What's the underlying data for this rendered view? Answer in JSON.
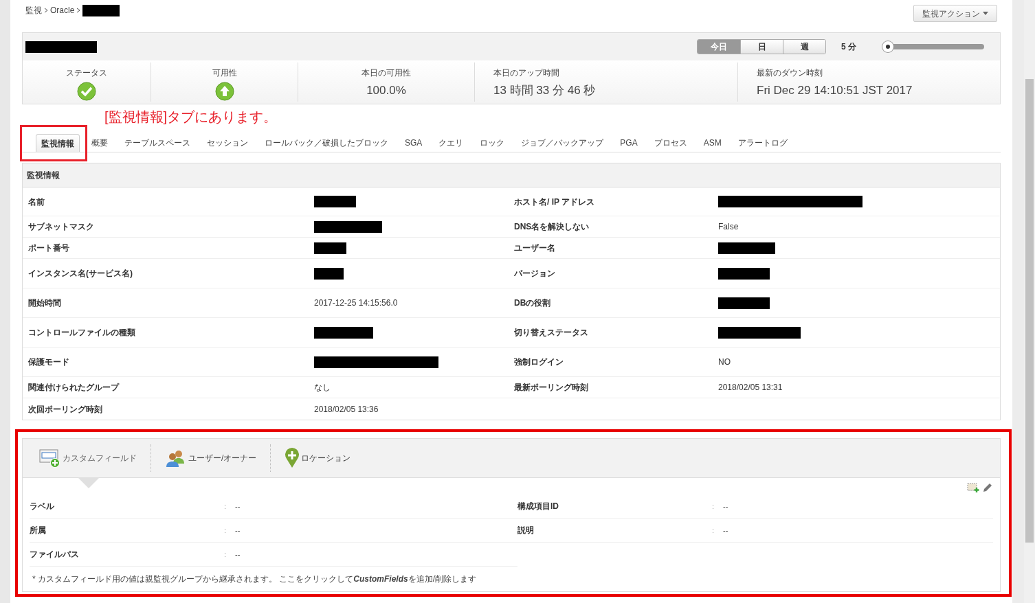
{
  "breadcrumb": [
    {
      "text": "監視"
    },
    {
      "text": "Oracle"
    }
  ],
  "action_button": {
    "label": "監視アクション"
  },
  "range_buttons": [
    {
      "label": "今日",
      "selected": true
    },
    {
      "label": "日",
      "selected": false
    },
    {
      "label": "週",
      "selected": false
    }
  ],
  "interval": {
    "reading": "5 分",
    "level": 0.0
  },
  "stats": [
    {
      "label": "ステータス",
      "kind": "check"
    },
    {
      "label": "可用性",
      "kind": "up"
    },
    {
      "label": "本日の可用性",
      "kind": "text",
      "value": "100.0%"
    },
    {
      "label": "本日のアップ時間",
      "kind": "text",
      "value": "13 時間 33 分 46 秒"
    },
    {
      "label": "最新のダウン時刻",
      "kind": "text",
      "value": "Fri Dec 29 14:10:51 JST 2017"
    }
  ],
  "annotation": {
    "text": "[監視情報]タブにあります。"
  },
  "tabs": [
    {
      "label": "監視情報",
      "selected": true
    },
    {
      "label": "概要",
      "selected": false
    },
    {
      "label": "テーブルスペース",
      "selected": false
    },
    {
      "label": "セッション",
      "selected": false
    },
    {
      "label": "ロールバック／破損したブロック",
      "selected": false
    },
    {
      "label": "SGA",
      "selected": false
    },
    {
      "label": "クエリ",
      "selected": false
    },
    {
      "label": "ロック",
      "selected": false
    },
    {
      "label": "ジョブ／バックアップ",
      "selected": false
    },
    {
      "label": "PGA",
      "selected": false
    },
    {
      "label": "プロセス",
      "selected": false
    },
    {
      "label": "ASM",
      "selected": false
    },
    {
      "label": "アラートログ",
      "selected": false
    }
  ],
  "info": {
    "title": "監視情報",
    "rows": [
      {
        "left": {
          "label": "名前",
          "redacted": true
        },
        "right": {
          "label": "ホスト名/ IP アドレス",
          "redacted": true
        }
      },
      {
        "left": {
          "label": "サブネットマスク",
          "redacted": true
        },
        "right": {
          "label": "DNS名を解決しない",
          "value": "False"
        }
      },
      {
        "left": {
          "label": "ポート番号",
          "redacted": true
        },
        "right": {
          "label": "ユーザー名",
          "redacted": true
        }
      },
      {
        "left": {
          "label": "インスタンス名(サービス名)",
          "redacted": true
        },
        "right": {
          "label": "バージョン",
          "redacted": true
        }
      },
      {
        "left": {
          "label": "開始時間",
          "value": "2017-12-25 14:15:56.0"
        },
        "right": {
          "label": "DBの役割",
          "redacted": true
        }
      },
      {
        "left": {
          "label": "コントロールファイルの種類",
          "redacted": true
        },
        "right": {
          "label": "切り替えステータス",
          "redacted": true
        }
      },
      {
        "left": {
          "label": "保護モード",
          "redacted": true
        },
        "right": {
          "label": "強制ログイン",
          "value": "NO"
        }
      },
      {
        "left": {
          "label": "関連付けられたグループ",
          "value": "なし"
        },
        "right": {
          "label": "最新ポーリング時刻",
          "value": "2018/02/05 13:31"
        }
      },
      {
        "left": {
          "label": "次回ポーリング時刻",
          "value": "2018/02/05 13:36"
        }
      }
    ]
  },
  "custom_panel": {
    "tabs": [
      {
        "label": "カスタムフィールド",
        "kind": "field",
        "selected": true
      },
      {
        "label": "ユーザー/オーナー",
        "kind": "users",
        "selected": false
      },
      {
        "label": "ロケーション",
        "kind": "pin",
        "selected": false
      }
    ],
    "fields_left": [
      {
        "label": "ラベル",
        "colon": ":",
        "value": "--"
      },
      {
        "label": "所属",
        "colon": ":",
        "value": "--"
      },
      {
        "label": "ファイルパス",
        "colon": ":",
        "value": "--"
      }
    ],
    "fields_right": [
      {
        "label": "構成項目ID",
        "colon": ":",
        "value": "--"
      },
      {
        "label": "説明",
        "colon": ":",
        "value": "--"
      }
    ],
    "note": "* カスタムフィールド用の値は親監視グループから継承されます。 ここをクリックして**CustomFields**を追加/削除します"
  }
}
